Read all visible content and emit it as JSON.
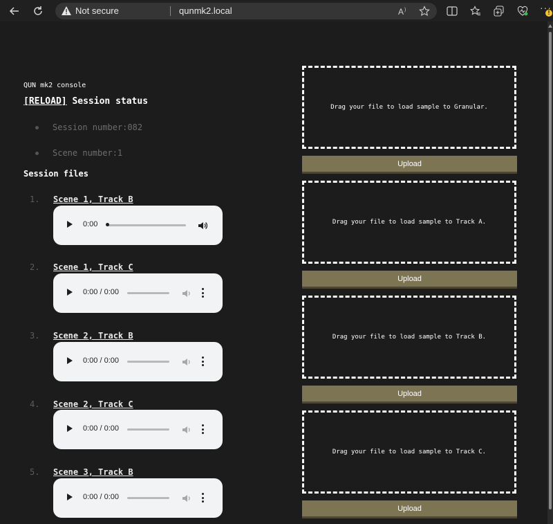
{
  "browser": {
    "security_label": "Not secure",
    "url": "qunmk2.local",
    "notification_badge": "!"
  },
  "page": {
    "console_title": "QUN mk2 console",
    "reload_label": "[RELOAD]",
    "status_heading": "Session status",
    "status_items": [
      "Session number:082",
      "Scene number:1"
    ],
    "files_heading": "Session files",
    "files": [
      {
        "number": "1.",
        "label": "Scene 1, Track B",
        "time": "0:00",
        "player_state": "loaded"
      },
      {
        "number": "2.",
        "label": "Scene 1, Track C",
        "time": "0:00 / 0:00",
        "player_state": "empty"
      },
      {
        "number": "3.",
        "label": "Scene 2, Track B",
        "time": "0:00 / 0:00",
        "player_state": "empty"
      },
      {
        "number": "4.",
        "label": "Scene 2, Track C",
        "time": "0:00 / 0:00",
        "player_state": "empty"
      },
      {
        "number": "5.",
        "label": "Scene 3, Track B",
        "time": "0:00 / 0:00",
        "player_state": "empty"
      }
    ],
    "dropzones": [
      {
        "text": "Drag your file to load sample to Granular.",
        "button": "Upload"
      },
      {
        "text": "Drag your file to load sample to Track A.",
        "button": "Upload"
      },
      {
        "text": "Drag your file to load sample to Track B.",
        "button": "Upload"
      },
      {
        "text": "Drag your file to load sample to Track C.",
        "button": "Upload"
      }
    ]
  },
  "colors": {
    "background": "#1c1c1c",
    "upload_button": "#7c7453",
    "player_bg": "#f1f3f4"
  }
}
